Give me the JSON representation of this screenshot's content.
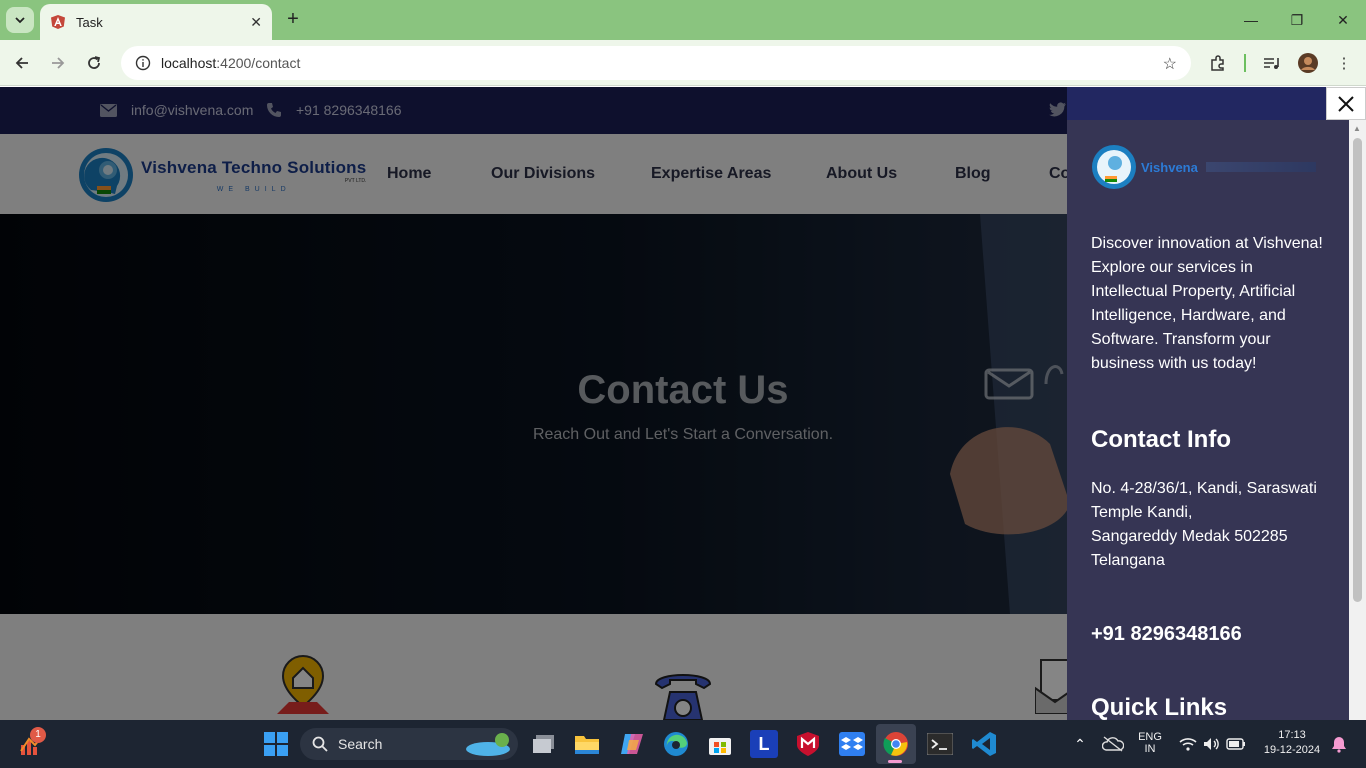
{
  "browser": {
    "tab_title": "Task",
    "url_host": "localhost",
    "url_path": ":4200/contact"
  },
  "site": {
    "topbar": {
      "email": "info@vishvena.com",
      "phone": "+91 8296348166"
    },
    "logo": {
      "name": "Vishvena Techno Solutions",
      "tagline": "WE BUILD",
      "suffix": "PVT LTD."
    },
    "nav": [
      "Home",
      "Our Divisions",
      "Expertise Areas",
      "About Us",
      "Blog",
      "Co"
    ],
    "hero": {
      "title": "Contact Us",
      "subtitle": "Reach Out and Let's Start a Conversation."
    }
  },
  "panel": {
    "logo_name": "Vishvena",
    "intro": "Discover innovation at Vishvena! Explore our services in Intellectual Property, Artificial Intelligence, Hardware, and Software. Transform your business with us today!",
    "contact_heading": "Contact Info",
    "address_line1": "No. 4-28/36/1, Kandi, Saraswati Temple Kandi,",
    "address_line2": "Sangareddy Medak 502285",
    "address_line3": "Telangana",
    "phone": "+91 8296348166",
    "quick_links_heading": "Quick Links"
  },
  "taskbar": {
    "search_label": "Search",
    "lang_line1": "ENG",
    "lang_line2": "IN",
    "time": "17:13",
    "date": "19-12-2024",
    "notification_count": "1",
    "l_app_letter": "L"
  },
  "colors": {
    "tabstrip": "#8ac47f",
    "site_topbar": "#1b1f56",
    "panel_bg": "#363554",
    "taskbar": "#1d2532"
  }
}
